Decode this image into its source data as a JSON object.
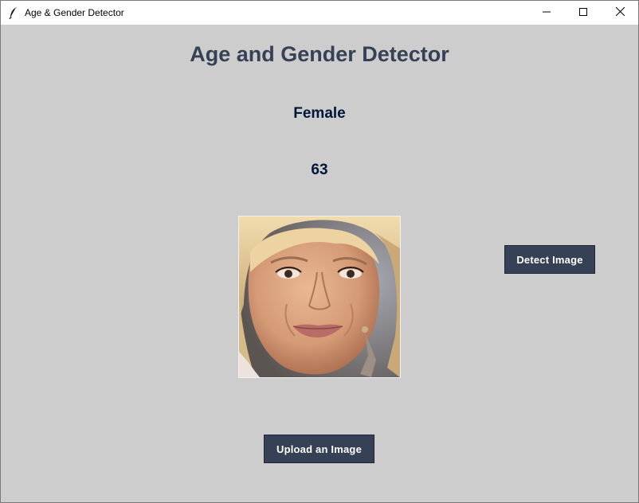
{
  "window": {
    "title": "Age & Gender Detector",
    "icon": "feather-icon",
    "controls": [
      "minimize-icon",
      "maximize-icon",
      "close-icon"
    ]
  },
  "main": {
    "heading": "Age and Gender Detector",
    "gender_result": "Female",
    "age_result": "63",
    "photo": "uploaded-face-photo"
  },
  "buttons": {
    "detect_label": "Detect Image",
    "upload_label": "Upload an Image"
  },
  "colors": {
    "background": "#cdcdcd",
    "heading": "#364156",
    "result_text": "#011638",
    "button_bg": "#364156",
    "button_text": "#ffffff"
  }
}
